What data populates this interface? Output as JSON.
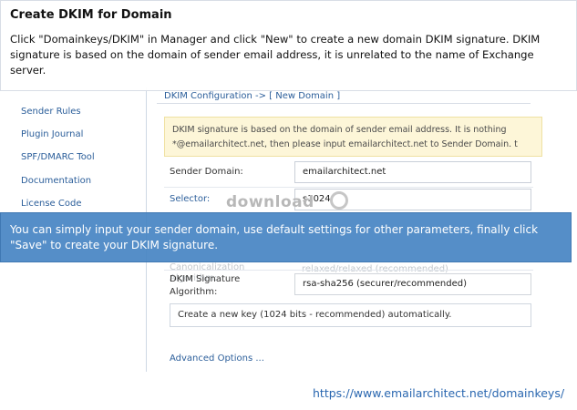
{
  "callout_top": {
    "title": "Create DKIM for Domain",
    "body": "Click \"Domainkeys/DKIM\" in Manager and click \"New\" to create a new domain DKIM signature. DKIM signature is based on the domain of sender email address, it is unrelated to the name of Exchange server."
  },
  "sidebar": {
    "items": [
      {
        "label": "Sender Rules"
      },
      {
        "label": "Plugin Journal"
      },
      {
        "label": "SPF/DMARC Tool"
      },
      {
        "label": "Documentation"
      },
      {
        "label": "License Code"
      }
    ]
  },
  "main": {
    "breadcrumb": "DKIM Configuration -> [ New Domain ]",
    "notice_line1": "DKIM signature is based on the domain of sender email address. It is nothing",
    "notice_line2": "*@emailarchitect.net, then please input emailarchitect.net to Sender Domain. t",
    "sender_domain_label": "Sender Domain:",
    "sender_domain_value": "emailarchitect.net",
    "selector_label": "Selector:",
    "selector_value": "s1024",
    "canon_label_faded": "Canonicalization Algorithm:",
    "canon_value_faded": "relaxed/relaxed (recommended)",
    "signature_label_line1": "DKIM Signature",
    "signature_label_line2": "Algorithm:",
    "signature_value": "rsa-sha256 (securer/recommended)",
    "key_option": "Create a new key (1024 bits - recommended) automatically.",
    "advanced_link": "Advanced Options ..."
  },
  "watermark": "download",
  "callout_blue": {
    "body": "You can simply input your sender domain, use default settings for other parameters, finally click \"Save\" to create your DKIM signature."
  },
  "footer_url": "https://www.emailarchitect.net/domainkeys/"
}
